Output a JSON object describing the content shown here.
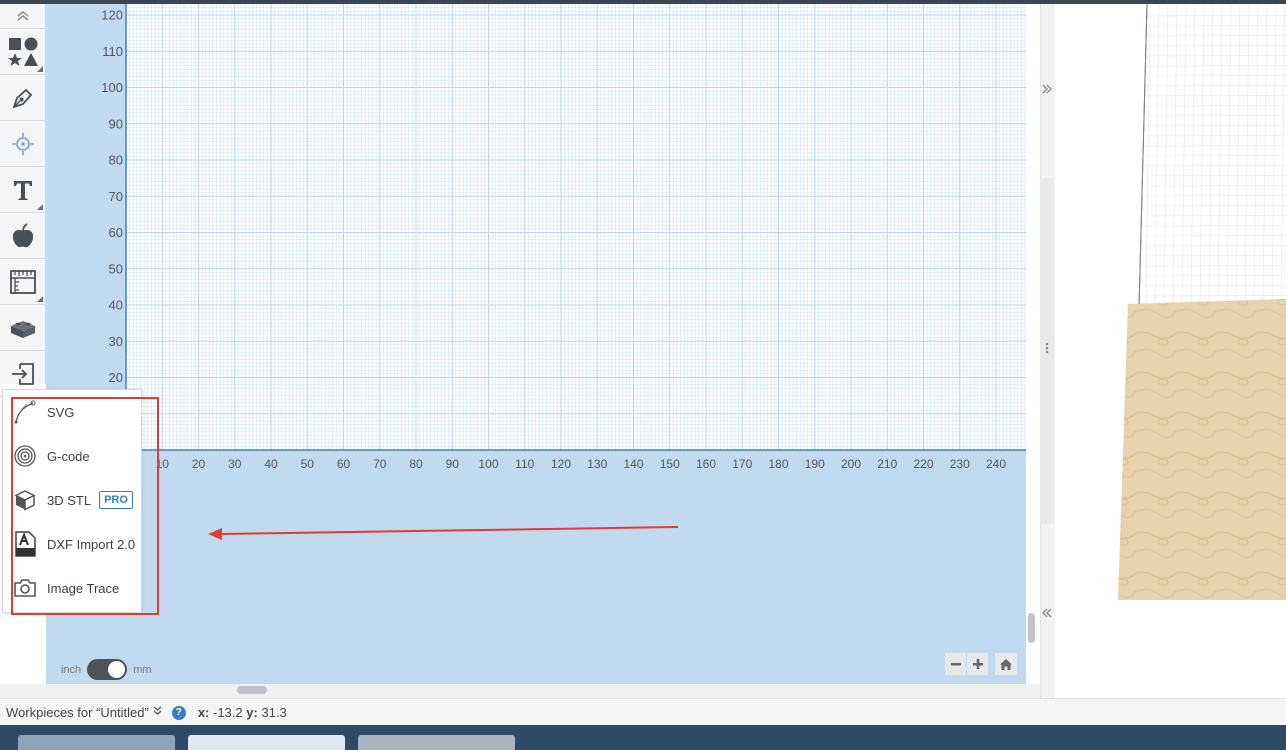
{
  "canvas": {
    "y_axis_labels": [
      "120",
      "110",
      "100",
      "90",
      "80",
      "70",
      "60",
      "50",
      "40",
      "30",
      "20"
    ],
    "x_axis_labels": [
      "10",
      "20",
      "30",
      "40",
      "50",
      "60",
      "70",
      "80",
      "90",
      "100",
      "110",
      "120",
      "130",
      "140",
      "150",
      "160",
      "170",
      "180",
      "190",
      "200",
      "210",
      "220",
      "230",
      "240",
      "2"
    ]
  },
  "toolbar": {
    "buttons": [
      {
        "icon": "shapes-icon"
      },
      {
        "icon": "pen-icon"
      },
      {
        "icon": "target-icon"
      },
      {
        "icon": "text-icon"
      },
      {
        "icon": "apple-icon"
      },
      {
        "icon": "ruler-icon"
      },
      {
        "icon": "blocks-icon"
      },
      {
        "icon": "import-icon"
      }
    ]
  },
  "import_menu": {
    "items": [
      {
        "label": "SVG",
        "icon": "svg-path-icon"
      },
      {
        "label": "G-code",
        "icon": "gcode-spiral-icon"
      },
      {
        "label": "3D STL",
        "icon": "cube-icon",
        "badge": "PRO"
      },
      {
        "label": "DXF Import 2.0",
        "icon": "dxf-file-icon"
      },
      {
        "label": "Image Trace",
        "icon": "camera-icon"
      }
    ]
  },
  "units": {
    "left": "inch",
    "right": "mm",
    "selected": "mm"
  },
  "status": {
    "workpieces": "Workpieces for “Untitled”",
    "help": "?",
    "x_label": "x:",
    "x_value": "-13.2",
    "y_label": "y:",
    "y_value": "31.3"
  },
  "colors": {
    "canvas_bg": "#c1daf0",
    "grid_bg": "#ffffff",
    "grid_line": "#cfe2f3",
    "axis_line": "#3f7fc4",
    "highlight": "#e53935",
    "wood": "#e6d2ad"
  }
}
